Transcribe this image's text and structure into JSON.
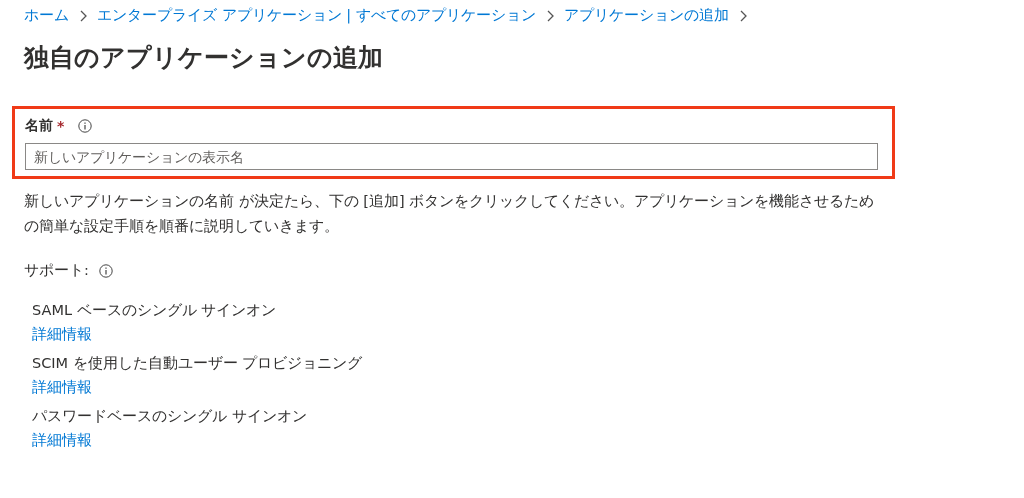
{
  "breadcrumb": [
    "ホーム",
    "エンタープライズ アプリケーション | すべてのアプリケーション",
    "アプリケーションの追加"
  ],
  "title": "独自のアプリケーションの追加",
  "name_field": {
    "label": "名前",
    "required_mark": "*",
    "placeholder": "新しいアプリケーションの表示名",
    "highlighted": true
  },
  "description": "新しいアプリケーションの名前 が決定たら、下の [追加] ボタンをクリックしてください。アプリケーションを機能させるための簡単な設定手順を順番に説明していきます。",
  "support": {
    "label": "サポート:",
    "items": [
      {
        "text": "SAML ベースのシングル サインオン",
        "link": "詳細情報"
      },
      {
        "text": "SCIM を使用した自動ユーザー プロビジョニング",
        "link": "詳細情報"
      },
      {
        "text": "パスワードベースのシングル サインオン",
        "link": "詳細情報"
      }
    ]
  }
}
